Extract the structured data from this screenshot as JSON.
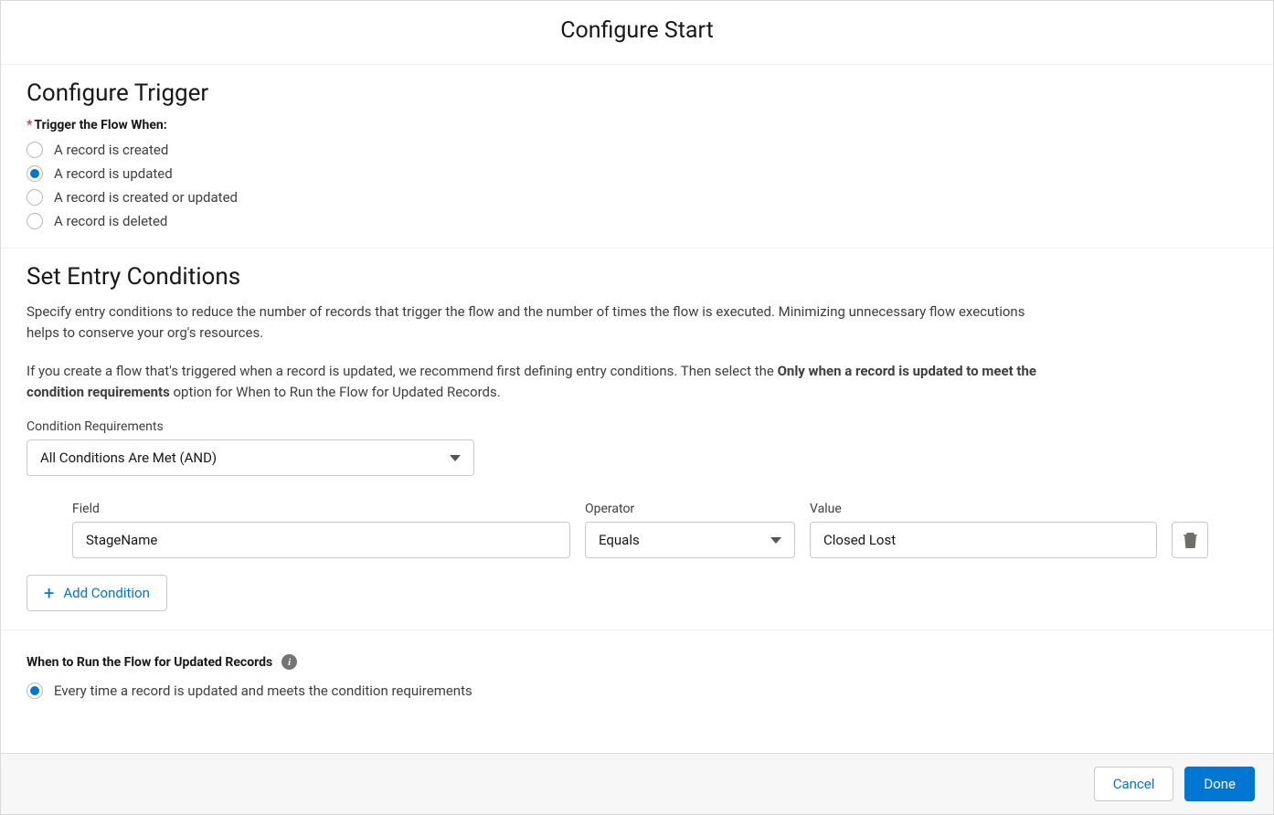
{
  "modal": {
    "title": "Configure Start"
  },
  "trigger": {
    "heading": "Configure Trigger",
    "label": "Trigger the Flow When:",
    "options": [
      {
        "label": "A record is created",
        "selected": false
      },
      {
        "label": "A record is updated",
        "selected": true
      },
      {
        "label": "A record is created or updated",
        "selected": false
      },
      {
        "label": "A record is deleted",
        "selected": false
      }
    ]
  },
  "entry": {
    "heading": "Set Entry Conditions",
    "help1": "Specify entry conditions to reduce the number of records that trigger the flow and the number of times the flow is executed. Minimizing unnecessary flow executions helps to conserve your org's resources.",
    "help2_pre": "If you create a flow that's triggered when a record is updated, we recommend first defining entry conditions. Then select the ",
    "help2_bold": "Only when a record is updated to meet the condition requirements",
    "help2_post": " option for When to Run the Flow for Updated Records.",
    "req_label": "Condition Requirements",
    "req_value": "All Conditions Are Met (AND)",
    "col_field": "Field",
    "col_operator": "Operator",
    "col_value": "Value",
    "row": {
      "field": "StageName",
      "operator": "Equals",
      "value": "Closed Lost"
    },
    "add_label": "Add Condition"
  },
  "when": {
    "heading": "When to Run the Flow for Updated Records",
    "options": [
      {
        "label": "Every time a record is updated and meets the condition requirements",
        "selected": true
      }
    ]
  },
  "footer": {
    "cancel": "Cancel",
    "done": "Done"
  }
}
